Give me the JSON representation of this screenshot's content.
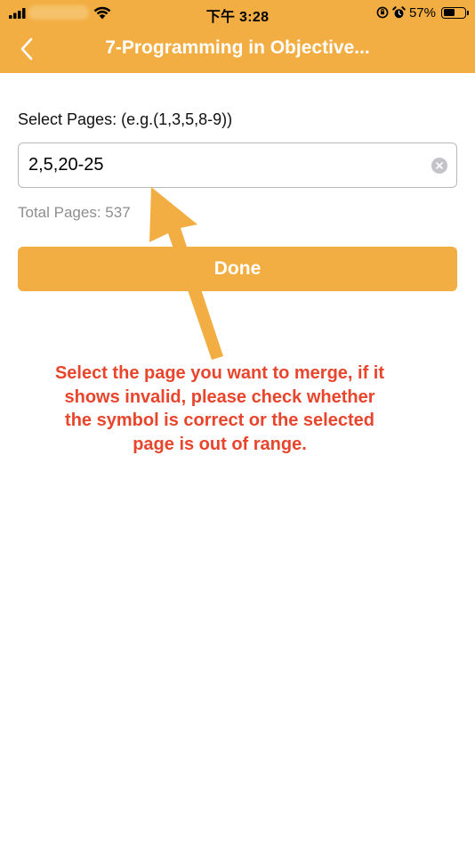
{
  "status_bar": {
    "time": "下午 3:28",
    "battery_percent": "57%",
    "battery_level": 0.57
  },
  "nav": {
    "title": "7-Programming in Objective...",
    "back_icon": "chevron-left-icon"
  },
  "form": {
    "select_label": "Select Pages: (e.g.(1,3,5,8-9))",
    "pages_value": "2,5,20-25",
    "total_pages": "Total Pages: 537",
    "done_label": "Done"
  },
  "annotation": {
    "text": "Select the page you want to merge, if it\nshows invalid, please check whether\nthe symbol is correct or the selected\npage is out of range."
  },
  "colors": {
    "accent": "#f2ae42",
    "annotation_text": "#e8452c",
    "annotation_arrow": "#f2ae42"
  }
}
